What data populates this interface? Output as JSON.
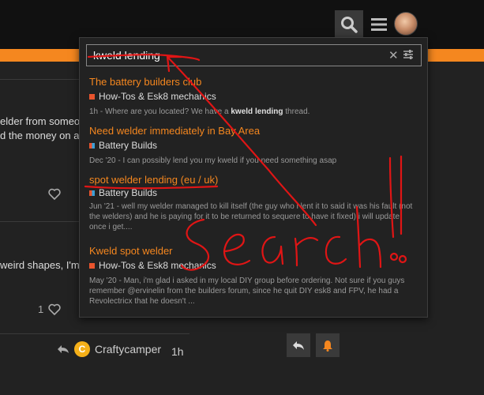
{
  "search": {
    "query": "kweld lending",
    "clear_icon": "close-icon",
    "filter_icon": "sliders-icon"
  },
  "results": [
    {
      "title": "The battery builders club",
      "category": "How-Tos & Esk8 mechanics",
      "blurb_prefix": "1h - Where are you located? We have a ",
      "blurb_bold": "kweld lending",
      "blurb_suffix": " thread."
    },
    {
      "title": "Need welder immediately in Bay Area",
      "category": "Battery Builds",
      "blurb": "Dec '20 - I can possibly lend you my kweld if you need something asap"
    },
    {
      "title": "spot welder lending (eu / uk)",
      "category": "Battery Builds",
      "blurb_line1": "Jun '21 - well my welder managed to kill itself (the guy who i lent it to said it was his fault (not",
      "blurb_line2": "the welders) and he is paying for it to be returned to sequere to have it fixed) i will update",
      "blurb_line3": "once i get...."
    },
    {
      "title": "Kweld spot welder",
      "category": "How-Tos & Esk8 mechanics",
      "blurb_line1": "May '20 - Man, i'm glad i asked in my local DIY group before ordering. Not sure if you guys",
      "blurb_line2": "remember @ervinelin from the builders forum, since he quit DIY esk8 and FPV, he had a",
      "blurb_line3": "Revolectricx that he doesn't ..."
    }
  ],
  "background": {
    "post1_line1": "elder from someo",
    "post1_line2": "d the money on a",
    "post2_line1": "weird shapes, I'm j",
    "like_count": "1",
    "reply_avatar_letter": "C",
    "reply_user": "Craftycamper",
    "reply_time": "1h"
  },
  "annotation": {
    "text": "search!!",
    "color": "#e01515"
  },
  "colors": {
    "accent": "#f5871f",
    "panel_bg": "#222222",
    "header_bg": "#111111"
  }
}
